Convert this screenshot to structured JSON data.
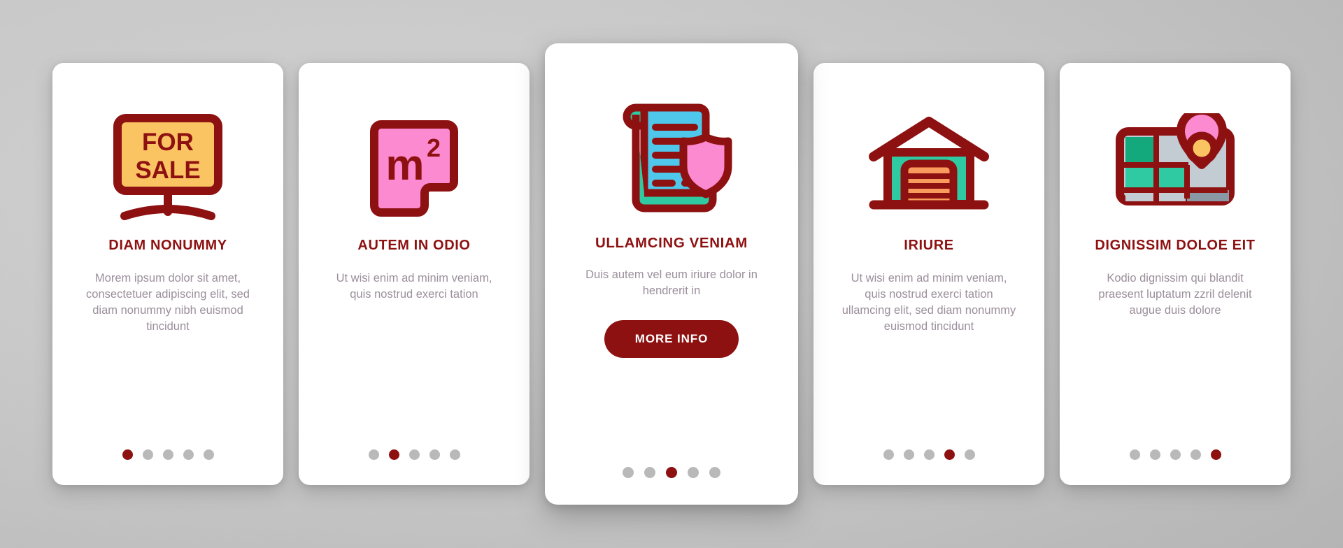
{
  "theme": {
    "background": "#c9c9c9",
    "card_background": "#ffffff",
    "title_color": "#8e1111",
    "body_color": "#9b8f9b",
    "accent_color": "#8e1111",
    "dot_inactive_color": "#b9b9b9",
    "icon_outline_color": "#8e1111",
    "icon_yellow": "#fbc463",
    "icon_pink": "#fb8ad0",
    "icon_cyan": "#4fc7ea",
    "icon_teal": "#2fc9a2",
    "icon_orange": "#f99b5c",
    "icon_grey": "#c3cbd3"
  },
  "cards": [
    {
      "id": "card-for-sale",
      "icon": "for-sale-sign-icon",
      "icon_text_line1": "FOR",
      "icon_text_line2": "SALE",
      "title": "DIAM NONUMMY",
      "body": "Morem ipsum dolor sit amet, consectetuer adipiscing elit, sed diam nonummy nibh euismod tincidunt",
      "dots_total": 5,
      "dot_active_index": 0,
      "featured": false,
      "has_button": false
    },
    {
      "id": "card-square-meters",
      "icon": "square-meters-icon",
      "title": "AUTEM IN ODIO",
      "body": "Ut wisi enim ad minim veniam, quis nostrud exerci tation",
      "dots_total": 5,
      "dot_active_index": 1,
      "featured": false,
      "has_button": false
    },
    {
      "id": "card-insured-contract",
      "icon": "contract-shield-icon",
      "title": "ULLAMCING VENIAM",
      "body": "Duis autem vel eum iriure dolor in hendrerit in",
      "button_label": "MORE INFO",
      "dots_total": 5,
      "dot_active_index": 2,
      "featured": true,
      "has_button": true
    },
    {
      "id": "card-garage",
      "icon": "garage-house-icon",
      "title": "IRIURE",
      "body": "Ut wisi enim ad minim veniam, quis nostrud exerci tation ullamcing elit, sed diam nonummy euismod tincidunt",
      "dots_total": 5,
      "dot_active_index": 3,
      "featured": false,
      "has_button": false
    },
    {
      "id": "card-map-location",
      "icon": "map-location-pin-icon",
      "title": "DIGNISSIM DOLOE EIT",
      "body": "Kodio dignissim qui blandit praesent luptatum zzril delenit augue duis dolore",
      "dots_total": 5,
      "dot_active_index": 4,
      "featured": false,
      "has_button": false
    }
  ]
}
